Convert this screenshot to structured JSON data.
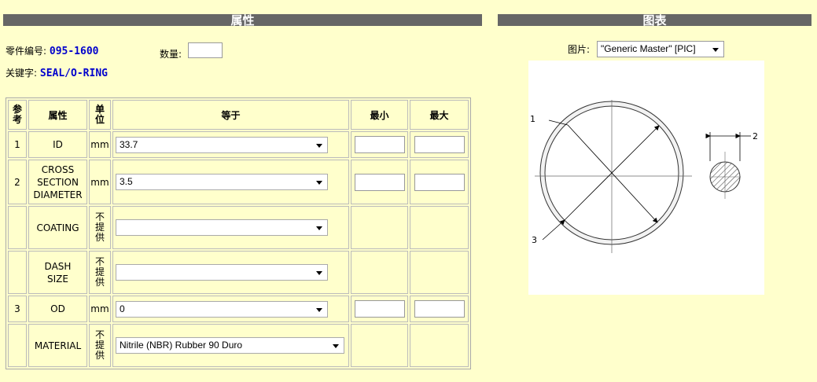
{
  "headers": {
    "left": "属性",
    "right": "图表"
  },
  "part": {
    "label": "零件编号:",
    "value": "095-1600"
  },
  "keyword": {
    "label": "关键字:",
    "value": "SEAL/O-RING"
  },
  "quantity": {
    "label": "数量:",
    "value": ""
  },
  "table": {
    "columns": [
      "参考",
      "属性",
      "单位",
      "等于",
      "最小",
      "最大"
    ],
    "rows": [
      {
        "ref": "1",
        "name": "ID",
        "unit": "mm",
        "equal": "33.7"
      },
      {
        "ref": "2",
        "name": "CROSS SECTION DIAMETER",
        "unit": "mm",
        "equal": "3.5"
      },
      {
        "ref": "",
        "name": "COATING",
        "unit": "不提供",
        "equal": ""
      },
      {
        "ref": "",
        "name": "DASH SIZE",
        "unit": "不提供",
        "equal": ""
      },
      {
        "ref": "3",
        "name": "OD",
        "unit": "mm",
        "equal": "0"
      },
      {
        "ref": "",
        "name": "MATERIAL",
        "unit": "不提供",
        "equal": "Nitrile (NBR) Rubber 90 Duro"
      }
    ]
  },
  "picture": {
    "label": "图片:",
    "selected": "\"Generic Master\" [PIC]"
  },
  "diagram_labels": {
    "one": "1",
    "two": "2",
    "three": "3"
  }
}
